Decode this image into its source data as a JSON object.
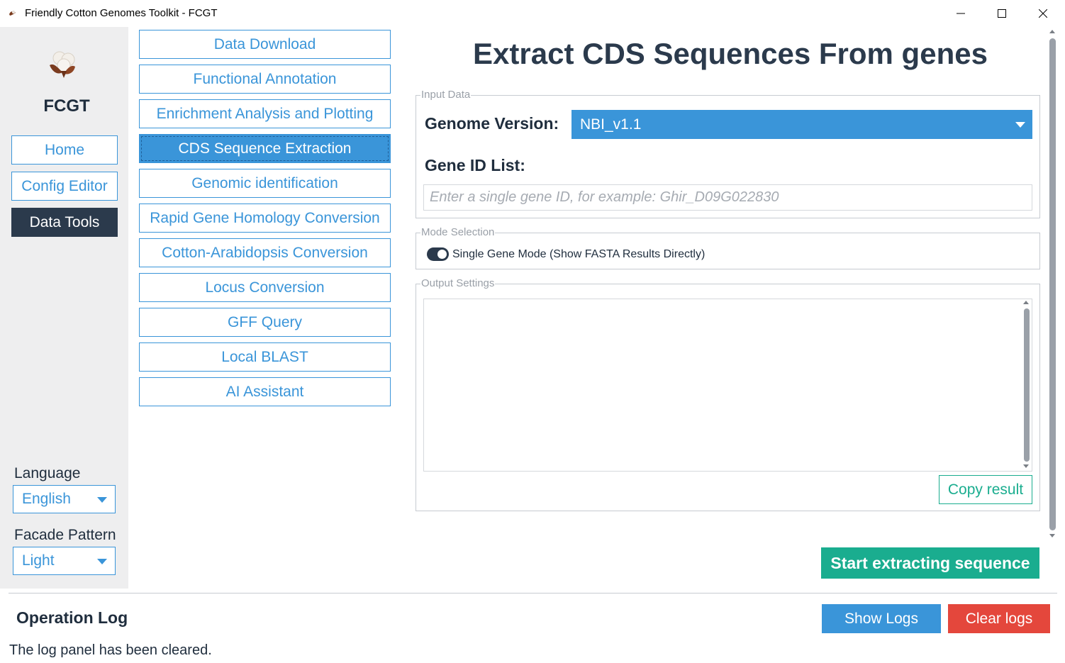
{
  "window": {
    "title": "Friendly Cotton Genomes Toolkit - FCGT",
    "minimize_icon": "minimize-icon",
    "maximize_icon": "maximize-icon",
    "close_icon": "close-icon"
  },
  "sidebar": {
    "logo_icon": "cotton-boll-icon",
    "brand": "FCGT",
    "nav": [
      {
        "label": "Home"
      },
      {
        "label": "Config Editor"
      },
      {
        "label": "Data Tools",
        "active": true
      }
    ],
    "language_label": "Language",
    "language_value": "English",
    "facade_label": "Facade Pattern",
    "facade_value": "Light"
  },
  "tools": [
    {
      "label": "Data Download"
    },
    {
      "label": "Functional Annotation"
    },
    {
      "label": "Enrichment Analysis and Plotting"
    },
    {
      "label": "CDS Sequence Extraction",
      "active": true
    },
    {
      "label": "Genomic identification"
    },
    {
      "label": "Rapid Gene Homology Conversion"
    },
    {
      "label": "Cotton-Arabidopsis Conversion"
    },
    {
      "label": "Locus Conversion"
    },
    {
      "label": "GFF Query"
    },
    {
      "label": "Local BLAST"
    },
    {
      "label": "AI Assistant"
    }
  ],
  "main": {
    "title": "Extract CDS Sequences From genes",
    "input_group_title": "Input Data",
    "genome_label": "Genome Version:",
    "genome_value": "NBI_v1.1",
    "gene_id_label": "Gene ID List:",
    "gene_id_placeholder": "Enter a single gene ID, for example: Ghir_D09G022830",
    "gene_id_value": "",
    "mode_group_title": "Mode Selection",
    "mode_toggle_label": "Single Gene Mode (Show FASTA Results Directly)",
    "mode_toggle_on": true,
    "output_group_title": "Output Settings",
    "output_text": "",
    "copy_label": "Copy result",
    "start_label": "Start extracting sequence"
  },
  "log": {
    "title": "Operation Log",
    "show_label": "Show Logs",
    "clear_label": "Clear logs",
    "message": "The log panel has been cleared."
  },
  "colors": {
    "accent": "#3a95d9",
    "dark": "#2b3a4c",
    "success": "#1aad8f",
    "danger": "#e4473c"
  }
}
